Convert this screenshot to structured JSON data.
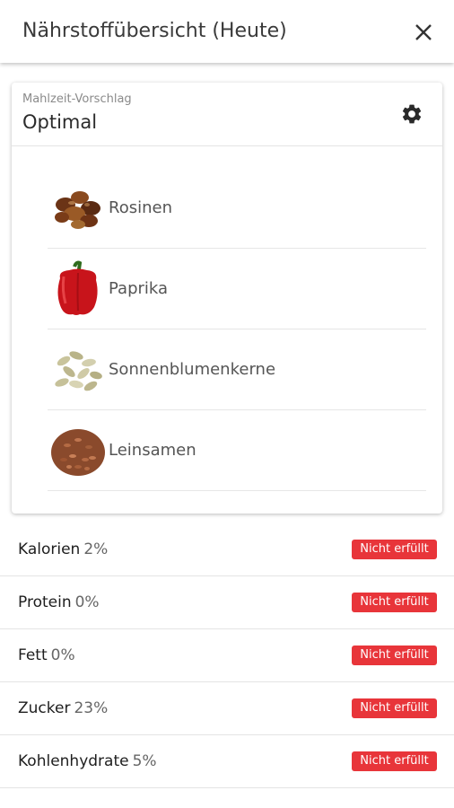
{
  "header": {
    "title": "Nährstoffübersicht (Heute)",
    "close_icon": "close-icon"
  },
  "meal": {
    "hint": "Mahlzeit-Vorschlag",
    "value": "Optimal",
    "settings_icon": "gear-icon",
    "foods": [
      {
        "label": "Rosinen",
        "icon": "raisins-image"
      },
      {
        "label": "Paprika",
        "icon": "red-pepper-image"
      },
      {
        "label": "Sonnenblumenkerne",
        "icon": "sunflower-seeds-image"
      },
      {
        "label": "Leinsamen",
        "icon": "flaxseed-image"
      }
    ]
  },
  "nutrients": [
    {
      "name": "Kalorien",
      "percent": "2%",
      "status": "Nicht erfüllt"
    },
    {
      "name": "Protein",
      "percent": "0%",
      "status": "Nicht erfüllt"
    },
    {
      "name": "Fett",
      "percent": "0%",
      "status": "Nicht erfüllt"
    },
    {
      "name": "Zucker",
      "percent": "23%",
      "status": "Nicht erfüllt"
    },
    {
      "name": "Kohlenhydrate",
      "percent": "5%",
      "status": "Nicht erfüllt"
    }
  ],
  "colors": {
    "status_unmet": "#e8353a",
    "divider": "#e4e4e4"
  }
}
